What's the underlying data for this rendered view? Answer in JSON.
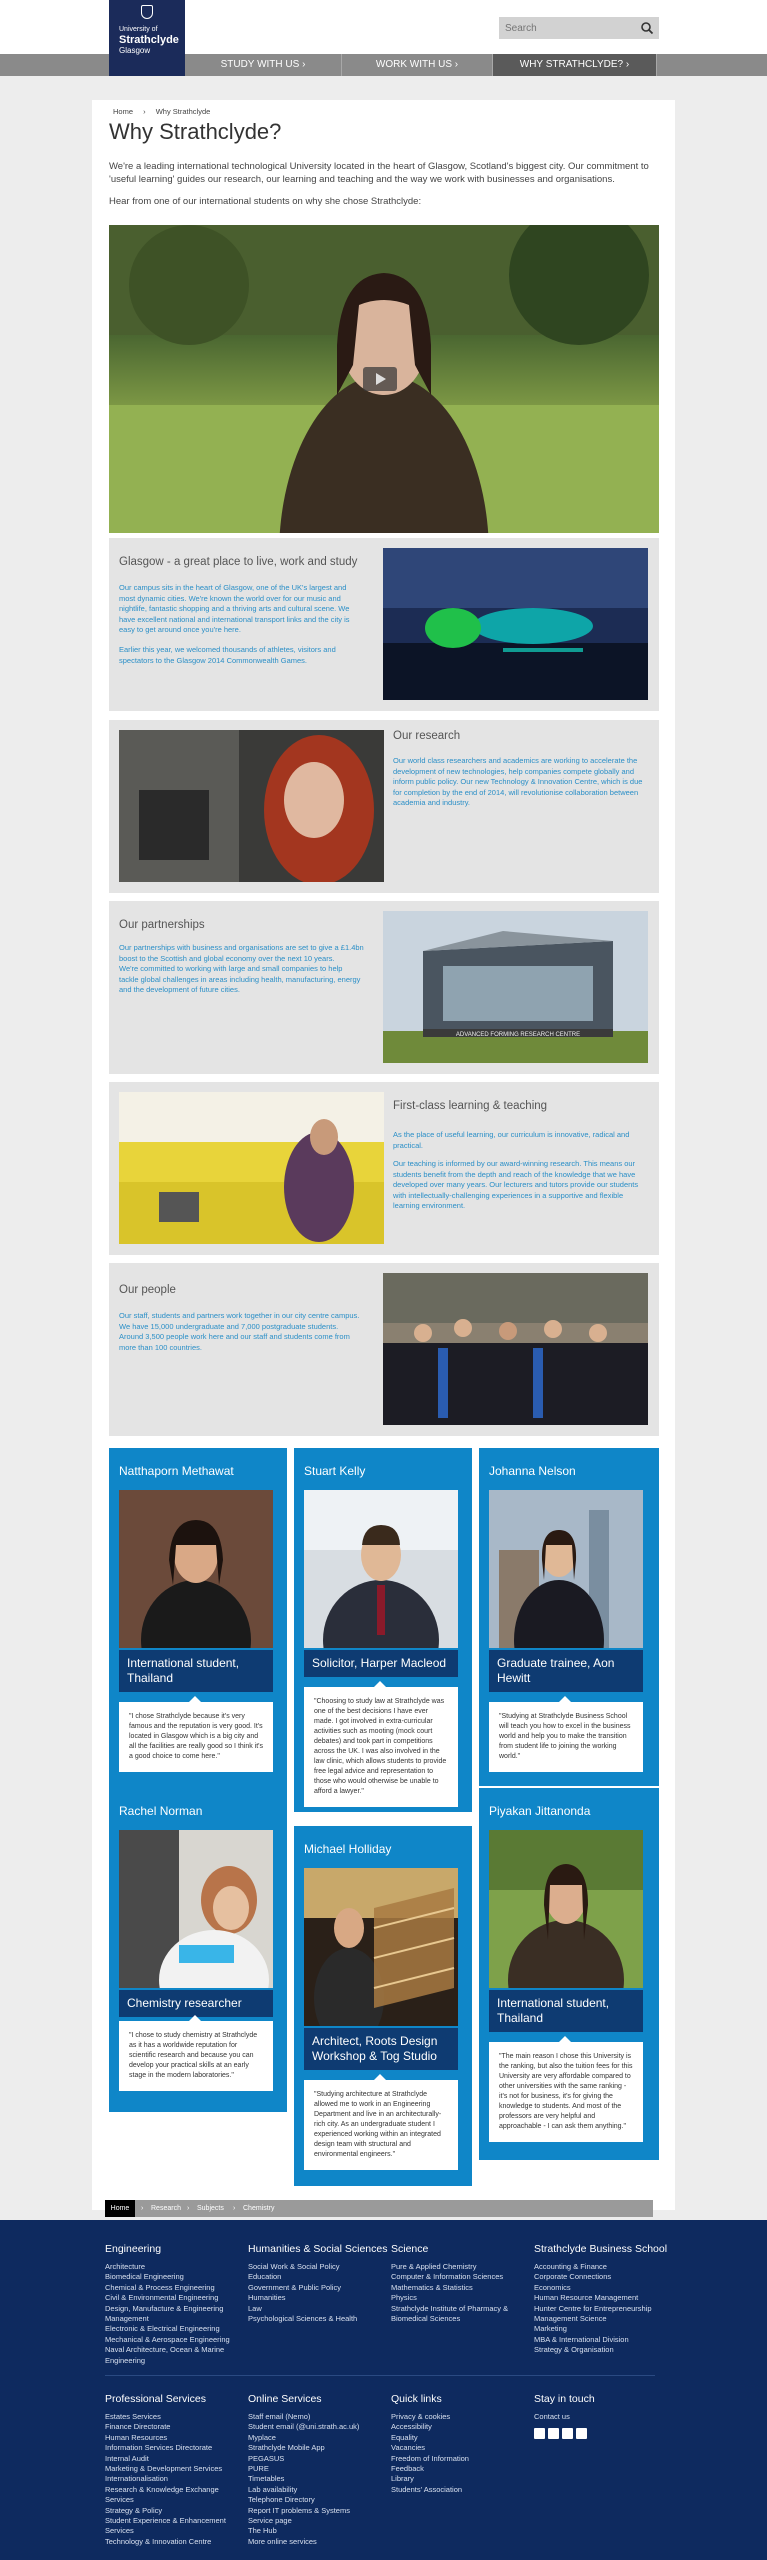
{
  "header": {
    "logo": {
      "line1": "University of",
      "line2": "Strathclyde",
      "line3": "Glasgow"
    },
    "search_placeholder": "Search",
    "search_icon": "search-icon"
  },
  "nav": {
    "items": [
      {
        "label": "STUDY WITH US ›",
        "active": false
      },
      {
        "label": "WORK WITH US ›",
        "active": false
      },
      {
        "label": "WHY STRATHCLYDE? ›",
        "active": true
      }
    ]
  },
  "breadcrumb": {
    "home": "Home",
    "sep": "›",
    "current": "Why Strathclyde"
  },
  "title": "Why Strathclyde?",
  "intro": "We're a leading international technological University located in the heart of Glasgow, Scotland's biggest city. Our commitment to 'useful learning' guides our research, our learning and teaching and the way we work with businesses and organisations.",
  "intro2": "Hear from one of our international students on why she chose Strathclyde:",
  "video": {
    "play_icon": "play-icon"
  },
  "panels": [
    {
      "title": "Glasgow - a great place to live, work and study",
      "text1": "Our campus sits in the heart of Glasgow, one of the UK's largest and most dynamic cities. We're known the world over for our music and nightlife, fantastic shopping and a thriving arts and cultural scene. We have excellent national and international transport links and the city is easy to get around once you're here.",
      "text2": "Earlier this year, we welcomed thousands of athletes, visitors and spectators to the Glasgow 2014 Commonwealth Games."
    },
    {
      "title": "Our research",
      "text1": "Our world class researchers and academics are working to accelerate the development of new technologies, help companies compete globally and inform public policy. Our new Technology & Innovation Centre, which is due for completion by the end of 2014, will revolutionise collaboration between academia and industry.",
      "text2": ""
    },
    {
      "title": "Our partnerships",
      "text1": "Our partnerships with business and organisations are set to give a £1.4bn boost to the Scottish and global economy over the next 10 years.",
      "text2": "We're committed to working with large and small companies to help tackle global challenges in areas including health, manufacturing, energy and the development of future cities.",
      "sign": "ADVANCED FORMING RESEARCH CENTRE"
    },
    {
      "title": "First-class learning & teaching",
      "text1": "As the place of useful learning, our curriculum is innovative, radical and practical.",
      "text2": "Our teaching is informed by our award-winning research. This means our students benefit from the depth and reach of the knowledge that we have developed over many years. Our lecturers and tutors provide our students with intellectually-challenging experiences in a supportive and flexible learning environment."
    },
    {
      "title": "Our people",
      "text1": "Our staff, students and partners work together in our city centre campus. We have 15,000 undergraduate and 7,000 postgraduate students. Around 3,500 people work here and our staff and students come from more than 100 countries.",
      "text2": ""
    }
  ],
  "cards": [
    {
      "name": "Natthaporn Methawat",
      "role": "International student, Thailand",
      "quote": "\"I chose Strathclyde because it's very famous and the reputation is very good. It's located in Glasgow which is a big city and all the facilities are really good so I think it's a good choice to come here.\""
    },
    {
      "name": "Stuart Kelly",
      "role": "Solicitor, Harper Macleod",
      "quote": "\"Choosing to study law at Strathclyde was one of the best decisions I have ever made. I got involved in extra-curricular activities such as mooting (mock court debates) and took part in competitions across the UK. I was also involved in the law clinic, which allows students to provide free legal advice and representation to those who would otherwise be unable to afford a lawyer.\""
    },
    {
      "name": "Johanna Nelson",
      "role": "Graduate trainee, Aon Hewitt",
      "quote": "\"Studying at Strathclyde Business School will teach you how to excel in the business world and help you to make the transition from student life to joining the working world.\""
    },
    {
      "name": "Rachel Norman",
      "role": "Chemistry researcher",
      "quote": "\"I chose to study chemistry at Strathclyde as it has a worldwide reputation for scientific research and because you can develop your practical skills at an early stage in the modern laboratories.\""
    },
    {
      "name": "Michael Holliday",
      "role": "Architect, Roots Design Workshop & Tog Studio",
      "quote": "\"Studying architecture at Strathclyde allowed me to work in an Engineering Department and live in an architecturally-rich city. As an undergraduate student I experienced working within an integrated design team with structural and environmental engineers.\""
    },
    {
      "name": "Piyakan Jittanonda",
      "role": "International student, Thailand",
      "quote": "\"The main reason I chose this University is the ranking, but also the tuition fees for this University are very affordable compared to other universities with the same ranking - it's not for business, it's for giving the knowledge to students. And most of the professors are very helpful and approachable - I can ask them anything.\""
    }
  ],
  "footer_crumb": [
    "Home",
    "›",
    "Research",
    "›",
    "Subjects",
    "›",
    "Chemistry"
  ],
  "footer": {
    "columns": [
      {
        "heading": "Engineering",
        "links": [
          "Architecture",
          "Biomedical Engineering",
          "Chemical & Process Engineering",
          "Civil & Environmental Engineering",
          "Design, Manufacture & Engineering Management",
          "Electronic & Electrical Engineering",
          "Mechanical & Aerospace Engineering",
          "Naval Architecture, Ocean & Marine Engineering"
        ]
      },
      {
        "heading": "Humanities & Social Sciences",
        "links": [
          "Social Work & Social Policy",
          "Education",
          "Government & Public Policy",
          "Humanities",
          "Law",
          "Psychological Sciences & Health"
        ]
      },
      {
        "heading": "Science",
        "links": [
          "Pure & Applied Chemistry",
          "Computer & Information Sciences",
          "Mathematics & Statistics",
          "Physics",
          "Strathclyde Institute of Pharmacy & Biomedical Sciences"
        ]
      },
      {
        "heading": "Strathclyde Business School",
        "links": [
          "Accounting & Finance",
          "Corporate Connections",
          "Economics",
          "Human Resource Management",
          "Hunter Centre for Entrepreneurship",
          "Management Science",
          "Marketing",
          "MBA & International Division",
          "Strategy & Organisation"
        ]
      },
      {
        "heading": "Professional Services",
        "links": [
          "Estates Services",
          "Finance Directorate",
          "Human Resources",
          "Information Services Directorate",
          "Internal Audit",
          "Marketing & Development Services",
          "Internationalisation",
          "Research & Knowledge Exchange Services",
          "Strategy & Policy",
          "Student Experience & Enhancement Services",
          "Technology & Innovation Centre"
        ]
      },
      {
        "heading": "Online Services",
        "links": [
          "Staff email (Nemo)",
          "Student email (@uni.strath.ac.uk)",
          "Myplace",
          "Strathclyde Mobile App",
          "PEGASUS",
          "PURE",
          "Timetables",
          "Lab availability",
          "Telephone Directory",
          "Report IT problems & Systems",
          "Service page",
          "The Hub",
          "More online services"
        ]
      },
      {
        "heading": "Quick links",
        "links": [
          "Privacy & cookies",
          "Accessibility",
          "Equality",
          "Vacancies",
          "Freedom of Information",
          "Feedback",
          "Library",
          "Students' Association"
        ]
      },
      {
        "heading": "Stay in touch",
        "links": [
          "Contact us"
        ]
      }
    ],
    "social_icons": [
      "facebook-icon",
      "twitter-icon",
      "email-icon",
      "youtube-icon"
    ]
  }
}
